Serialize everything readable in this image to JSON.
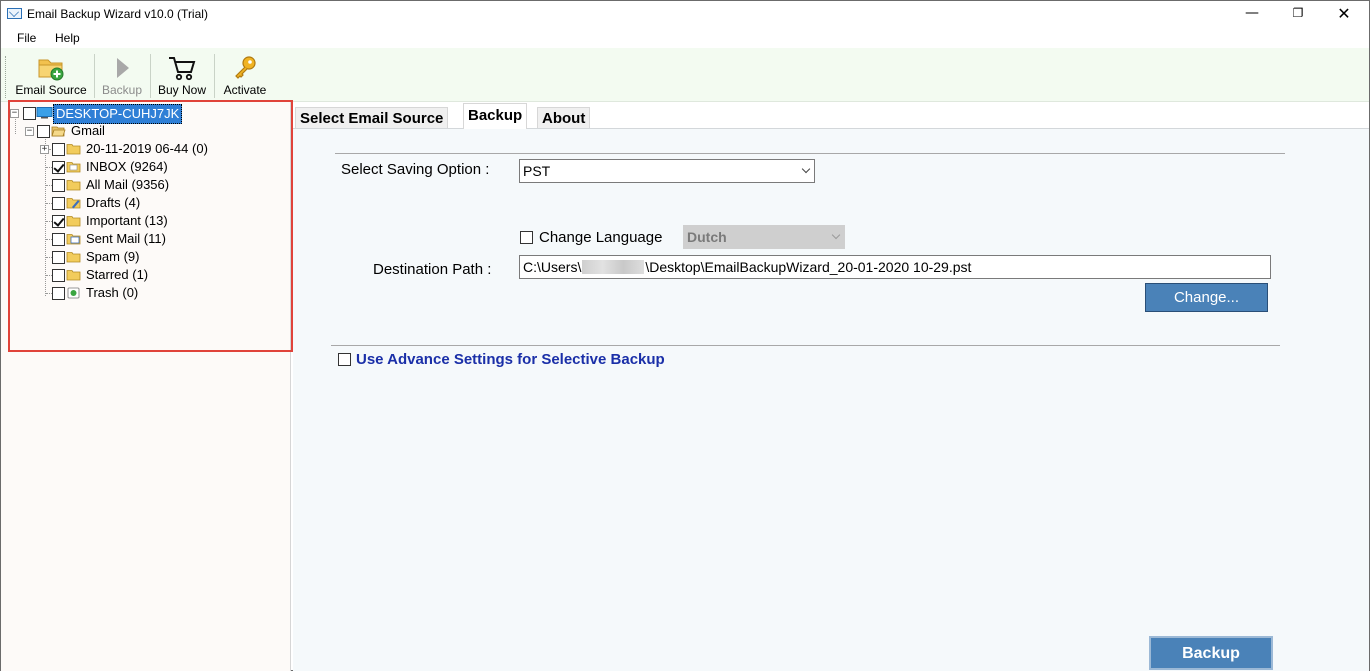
{
  "window": {
    "title": "Email Backup Wizard v10.0 (Trial)",
    "minimize": "—",
    "maximize": "❐",
    "close": "✕"
  },
  "menu": [
    "File",
    "Help"
  ],
  "toolbar": {
    "email_source": "Email Source",
    "backup": "Backup",
    "buy_now": "Buy Now",
    "activate": "Activate"
  },
  "tree": {
    "root": "DESKTOP-CUHJ7JK",
    "account": "Gmail",
    "folders": [
      {
        "label": "20-11-2019 06-44 (0)",
        "checked": false,
        "icon": "folder-icon",
        "expandable": true
      },
      {
        "label": "INBOX (9264)",
        "checked": true,
        "icon": "inbox-folder-icon"
      },
      {
        "label": "All Mail (9356)",
        "checked": false,
        "icon": "folder-icon"
      },
      {
        "label": "Drafts (4)",
        "checked": false,
        "icon": "drafts-icon"
      },
      {
        "label": "Important (13)",
        "checked": true,
        "icon": "folder-icon"
      },
      {
        "label": "Sent Mail (11)",
        "checked": false,
        "icon": "sent-mail-icon"
      },
      {
        "label": "Spam (9)",
        "checked": false,
        "icon": "folder-icon"
      },
      {
        "label": "Starred (1)",
        "checked": false,
        "icon": "folder-icon"
      },
      {
        "label": "Trash (0)",
        "checked": false,
        "icon": "trash-icon"
      }
    ]
  },
  "tabs": [
    "Select Email Source",
    "Backup",
    "About"
  ],
  "backup": {
    "saving_option_label": "Select Saving Option :",
    "saving_option_value": "PST",
    "change_language_label": "Change Language",
    "language_value": "Dutch",
    "destination_label": "Destination Path :",
    "destination_prefix": "C:\\Users\\",
    "destination_suffix": "\\Desktop\\EmailBackupWizard_20-01-2020 10-29.pst",
    "change_button": "Change...",
    "advance_settings_label": "Use Advance Settings for Selective Backup",
    "backup_button": "Backup"
  },
  "colors": {
    "toolbar_bg": "#f3fbf1",
    "highlight_border": "#e0433a",
    "button_blue": "#4a82b8",
    "advance_text": "#1a2fa8",
    "selection_blue": "#2f7fd6"
  }
}
